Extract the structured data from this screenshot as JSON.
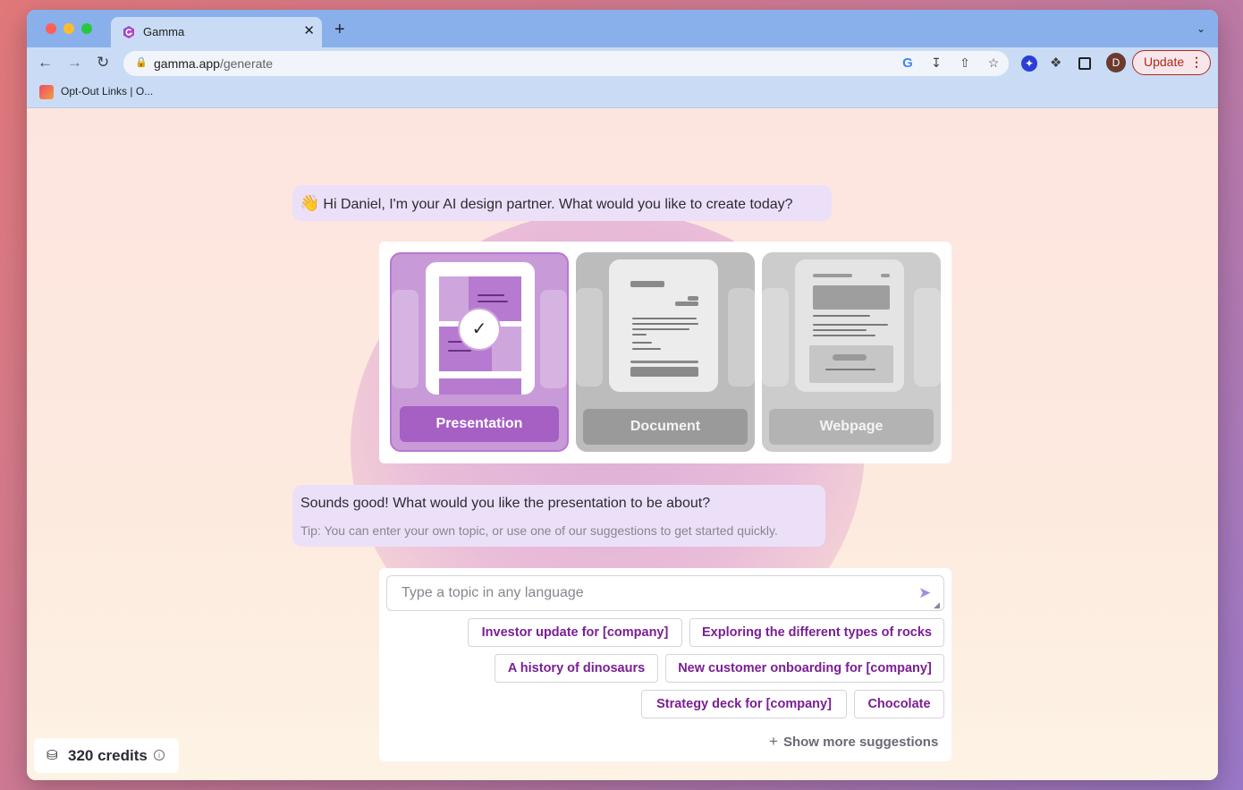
{
  "browser": {
    "tab_title": "Gamma",
    "tab_close_glyph": "✕",
    "new_tab_glyph": "+",
    "url_host": "gamma.app",
    "url_path": "/generate",
    "update_label": "Update",
    "profile_initial": "D",
    "bookmark_label": "Opt-Out Links | O...",
    "icons": [
      "back-icon",
      "forward-icon",
      "reload-icon",
      "lock-icon",
      "google-icon",
      "install-icon",
      "share-icon",
      "star-icon",
      "extension-icon",
      "puzzle-icon",
      "side-panel-icon"
    ]
  },
  "greeting": {
    "emoji": "👋",
    "text": "Hi Daniel, I'm your AI design partner. What would you like to create today?"
  },
  "formats": [
    {
      "label": "Presentation",
      "selected": true
    },
    {
      "label": "Document",
      "selected": false
    },
    {
      "label": "Webpage",
      "selected": false
    }
  ],
  "prompt": {
    "question": "Sounds good! What would you like the presentation to be about?",
    "tip": "Tip: You can enter your own topic, or use one of our suggestions to get started quickly."
  },
  "composer": {
    "placeholder": "Type a topic in any language",
    "suggestions": [
      "Investor update for [company]",
      "Exploring the different types of rocks",
      "A history of dinosaurs",
      "New customer onboarding for [company]",
      "Strategy deck for [company]",
      "Chocolate"
    ],
    "more_label": "Show more suggestions"
  },
  "credits": {
    "label": "320 credits"
  },
  "colors": {
    "accent": "#7a1f93",
    "selected_card": "#c89bd8",
    "bubble": "#ece0f8"
  }
}
